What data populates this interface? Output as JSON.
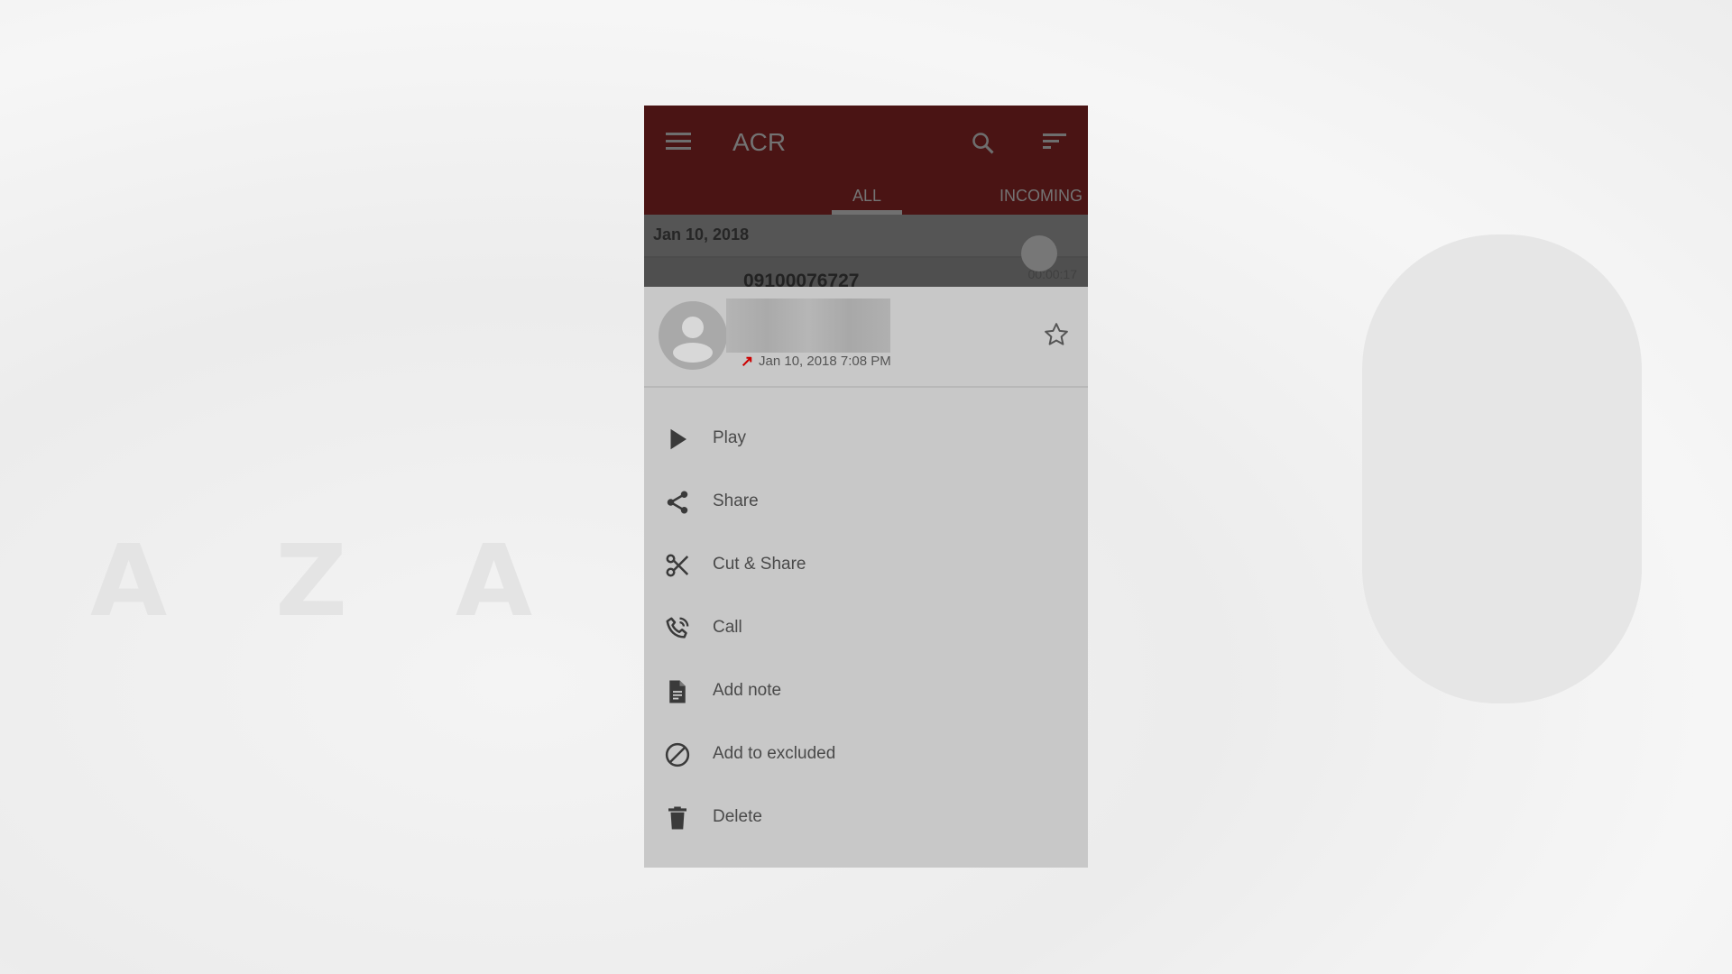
{
  "app": {
    "title": "ACR",
    "tabs": [
      {
        "label": "ALL",
        "active": true
      },
      {
        "label": "INCOMING",
        "active": false
      }
    ],
    "accent": "#4a1414"
  },
  "list": {
    "date_header": "Jan 10, 2018",
    "row": {
      "number": "09100076727",
      "duration": "00:00:17"
    }
  },
  "sheet": {
    "timestamp": "Jan 10, 2018 7:08 PM",
    "call_direction": "outgoing",
    "items": [
      {
        "label": "Play",
        "icon": "play-icon"
      },
      {
        "label": "Share",
        "icon": "share-icon"
      },
      {
        "label": "Cut & Share",
        "icon": "scissors-icon"
      },
      {
        "label": "Call",
        "icon": "phone-icon"
      },
      {
        "label": "Add note",
        "icon": "note-icon"
      },
      {
        "label": "Add to excluded",
        "icon": "block-icon"
      },
      {
        "label": "Delete",
        "icon": "trash-icon"
      }
    ]
  }
}
